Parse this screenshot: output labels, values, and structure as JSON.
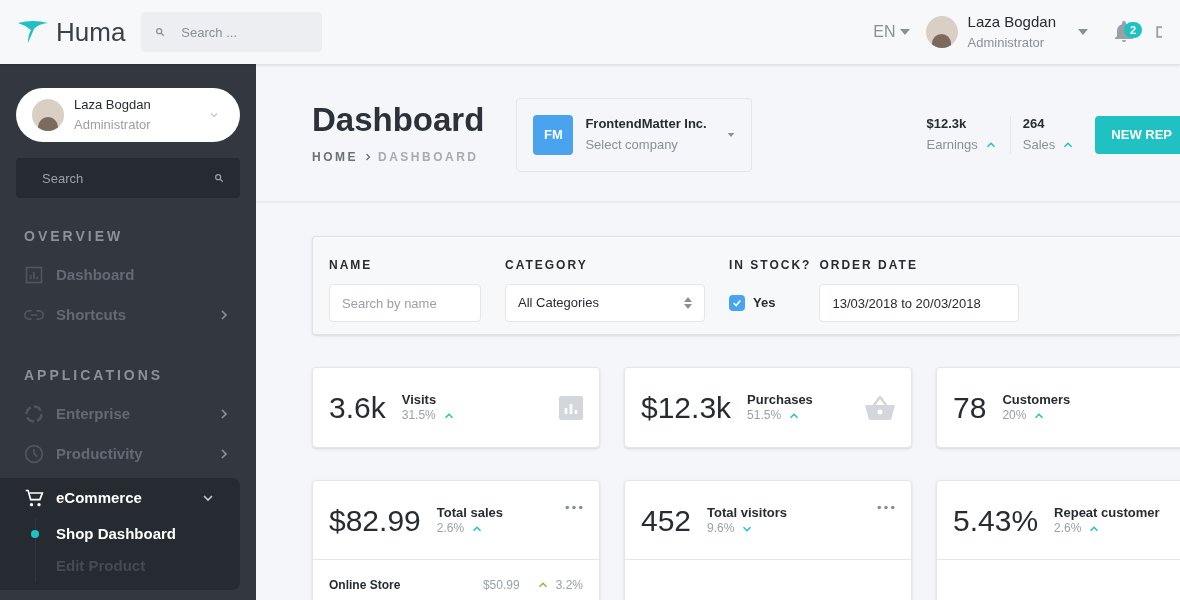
{
  "topbar": {
    "brand": "Huma",
    "search_placeholder": "Search ...",
    "language": "EN",
    "user": {
      "name": "Laza Bogdan",
      "role": "Administrator"
    },
    "notifications": "2"
  },
  "sidebar": {
    "profile": {
      "name": "Laza Bogdan",
      "role": "Administrator"
    },
    "search_placeholder": "Search",
    "sections": [
      {
        "title": "OVERVIEW",
        "items": [
          {
            "label": "Dashboard",
            "has_submenu": false,
            "expanded": false
          },
          {
            "label": "Shortcuts",
            "has_submenu": true,
            "expanded": false
          }
        ]
      },
      {
        "title": "APPLICATIONS",
        "items": [
          {
            "label": "Enterprise",
            "has_submenu": true,
            "expanded": false
          },
          {
            "label": "Productivity",
            "has_submenu": true,
            "expanded": false
          },
          {
            "label": "eCommerce",
            "has_submenu": true,
            "expanded": true,
            "children": [
              {
                "label": "Shop Dashboard",
                "selected": true
              },
              {
                "label": "Edit Product",
                "selected": false
              }
            ]
          }
        ]
      }
    ]
  },
  "header": {
    "title": "Dashboard",
    "breadcrumb": [
      "HOME",
      "DASHBOARD"
    ],
    "company": {
      "initials": "FM",
      "name": "FrontendMatter Inc.",
      "hint": "Select company"
    },
    "stats": [
      {
        "value": "$12.3k",
        "label": "Earnings",
        "rising": true
      },
      {
        "value": "264",
        "label": "Sales",
        "rising": true
      }
    ],
    "button": "NEW REP"
  },
  "filters": {
    "name": {
      "label": "NAME",
      "placeholder": "Search by name"
    },
    "category": {
      "label": "CATEGORY",
      "value": "All Categories"
    },
    "in_stock": {
      "label": "IN STOCK?",
      "option": "Yes",
      "checked": true
    },
    "order_date": {
      "label": "ORDER DATE",
      "value": "13/03/2018 to 20/03/2018"
    }
  },
  "stat_cards": [
    {
      "value": "3.6k",
      "label": "Visits",
      "change": "31.5%",
      "rising": true,
      "kind": "chart"
    },
    {
      "value": "$12.3k",
      "label": "Purchases",
      "change": "51.5%",
      "rising": true,
      "kind": "basket"
    },
    {
      "value": "78",
      "label": "Customers",
      "change": "20%",
      "rising": true,
      "kind": "none"
    }
  ],
  "detail_cards": [
    {
      "value": "$82.99",
      "label": "Total sales",
      "change": "2.6%",
      "rising": true,
      "menu": true,
      "rows": [
        {
          "name": "Online Store",
          "amount": "$50.99",
          "change": "3.2%",
          "rising": true
        }
      ]
    },
    {
      "value": "452",
      "label": "Total visitors",
      "change": "9.6%",
      "rising": false,
      "menu": true
    },
    {
      "value": "5.43%",
      "label": "Repeat customer",
      "change": "2.6%",
      "rising": true,
      "menu": false
    }
  ]
}
